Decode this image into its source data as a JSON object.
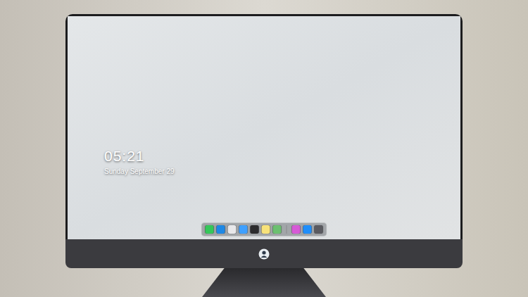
{
  "lock_screen": {
    "time": "05:21",
    "date": "Sunday September 29"
  },
  "dock": {
    "items": [
      {
        "kind": "app",
        "color": "#34c759"
      },
      {
        "kind": "app",
        "color": "#1e88e5"
      },
      {
        "kind": "app",
        "color": "#e8e8ea"
      },
      {
        "kind": "app",
        "color": "#3fa0ff"
      },
      {
        "kind": "app",
        "color": "#2c2c2e"
      },
      {
        "kind": "app",
        "color": "#f7e27a"
      },
      {
        "kind": "app",
        "color": "#6cc070"
      },
      {
        "kind": "separator",
        "color": "#8a8a8e"
      },
      {
        "kind": "app",
        "color": "#d65ad6"
      },
      {
        "kind": "app",
        "color": "#1f8efa"
      },
      {
        "kind": "app",
        "color": "#5a5a60"
      }
    ]
  }
}
